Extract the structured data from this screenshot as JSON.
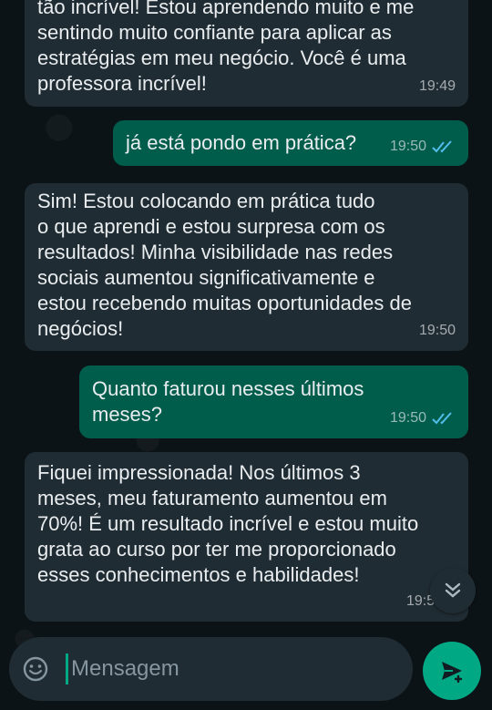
{
  "messages": [
    {
      "direction": "incoming",
      "text": "tão incrível! Estou aprendendo muito e me\nsentindo muito confiante para aplicar as\nestratégias em meu negócio. Você é uma\nprofessora incrível!",
      "time": "19:49"
    },
    {
      "direction": "outgoing",
      "text": "já está pondo em prática?",
      "time": "19:50",
      "status_icon": "double-check-read-icon"
    },
    {
      "direction": "incoming",
      "text": "Sim! Estou colocando em prática tudo\no que aprendi e estou surpresa com os\nresultados! Minha visibilidade nas redes\nsociais aumentou significativamente e\nestou recebendo muitas oportunidades de\nnegócios!",
      "time": "19:50"
    },
    {
      "direction": "outgoing",
      "text": "Quanto faturou nesses últimos\nmeses?",
      "time": "19:50",
      "status_icon": "double-check-read-icon"
    },
    {
      "direction": "incoming",
      "text": "Fiquei impressionada! Nos últimos 3\nmeses, meu faturamento aumentou em\n70%! É um resultado incrível e estou muito\ngrata ao curso por ter me proporcionado\nesses conhecimentos e habilidades!",
      "time": "19:50"
    }
  ],
  "composer": {
    "placeholder": "Mensagem",
    "emoji_icon": "emoji-icon",
    "send_icon": "send-icon"
  },
  "scroll_button": {
    "icon": "double-chevron-down-icon"
  },
  "colors": {
    "background": "#0c1317",
    "incoming_bubble": "#202c33",
    "outgoing_bubble": "#005c4b",
    "accent": "#00a884",
    "read_ticks": "#53bdeb"
  }
}
